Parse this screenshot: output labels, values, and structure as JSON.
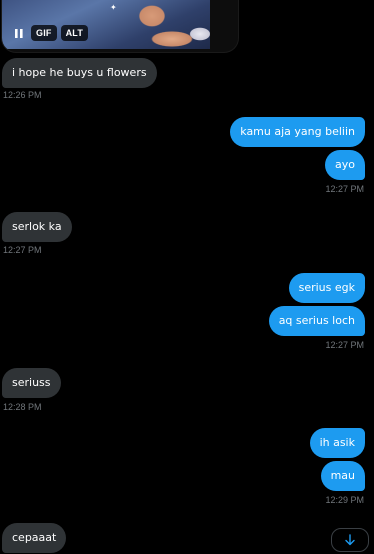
{
  "gif": {
    "badge": "GIF",
    "alt_badge": "ALT",
    "play_state": "paused"
  },
  "messages": [
    {
      "text": "i hope he buys u flowers",
      "direction": "in"
    },
    {
      "text": "kamu aja yang beliin",
      "direction": "out"
    },
    {
      "text": "ayo",
      "direction": "out"
    },
    {
      "text": "serlok ka",
      "direction": "in"
    },
    {
      "text": "serius egk",
      "direction": "out"
    },
    {
      "text": "aq serius loch",
      "direction": "out"
    },
    {
      "text": "seriuss",
      "direction": "in"
    },
    {
      "text": "ih asik",
      "direction": "out"
    },
    {
      "text": "mau",
      "direction": "out"
    },
    {
      "text": "cepaaat",
      "direction": "in"
    }
  ],
  "timestamps": [
    "12:26 PM",
    "12:27 PM",
    "12:27 PM",
    "12:27 PM",
    "12:28 PM",
    "12:29 PM"
  ],
  "colors": {
    "background": "#000000",
    "incoming_bubble": "#2f3336",
    "outgoing_bubble": "#1d9bf0",
    "timestamp": "#71767b",
    "scroll_arrow": "#1d9bf0"
  },
  "icons": {
    "pause": "pause-icon",
    "scroll_down": "arrow-down-icon"
  }
}
